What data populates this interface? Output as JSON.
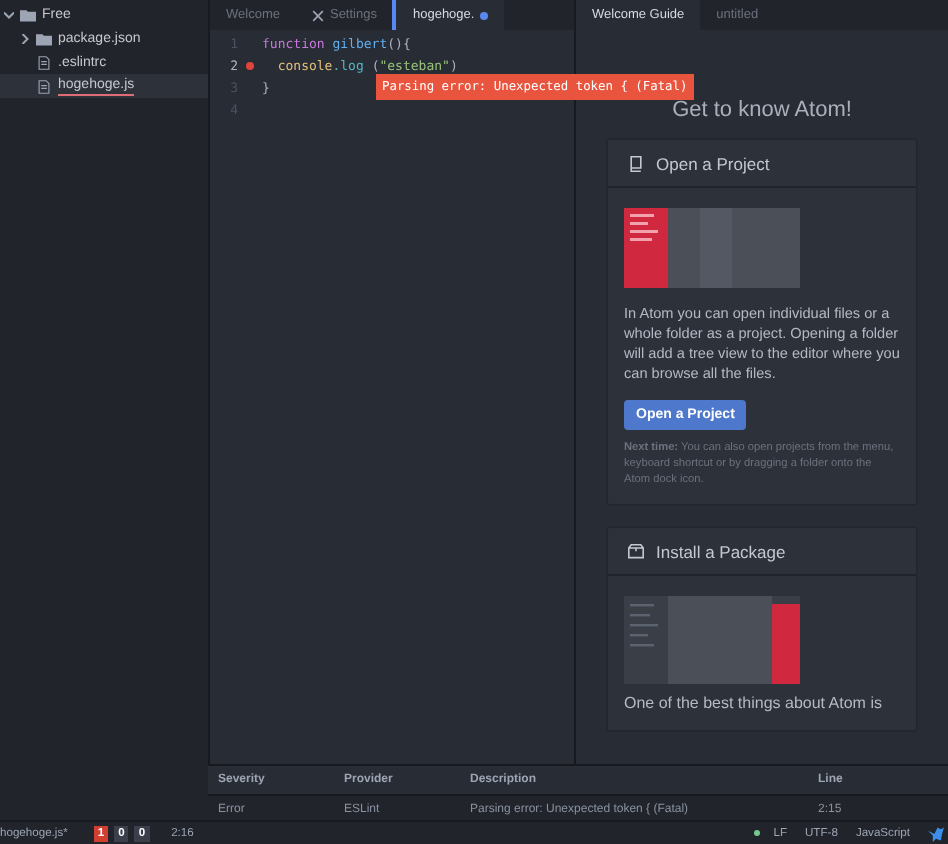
{
  "tree": {
    "label": "Free",
    "expanded": true,
    "children": [
      {
        "label": "package.json",
        "kind": "folder",
        "selected": false,
        "error": false
      },
      {
        "label": ".eslintrc",
        "kind": "file",
        "selected": false,
        "error": false
      },
      {
        "label": "hogehoge.js",
        "kind": "file",
        "selected": true,
        "error": true
      }
    ]
  },
  "editor_tabs": [
    {
      "label": "Welcome",
      "kind": "plain",
      "selected": false,
      "modified": false
    },
    {
      "label": "Settings",
      "kind": "settings",
      "selected": false,
      "modified": false
    },
    {
      "label": "hogehoge.",
      "kind": "plain",
      "selected": true,
      "modified": true
    }
  ],
  "code_lines": [
    {
      "number": "1",
      "error": false,
      "tokens": [
        {
          "text": "function ",
          "kind": "keyword"
        },
        {
          "text": "gilbert",
          "kind": "name"
        },
        {
          "text": "(){",
          "kind": "plain"
        }
      ]
    },
    {
      "number": "2",
      "error": true,
      "tokens": [
        {
          "text": "  console",
          "kind": "name2"
        },
        {
          "text": ".log ",
          "kind": "func"
        },
        {
          "text": "(",
          "kind": "plain"
        },
        {
          "text": "\"esteban\"",
          "kind": "string"
        },
        {
          "text": ")",
          "kind": "plain"
        }
      ]
    },
    {
      "number": "3",
      "error": false,
      "tokens": [
        {
          "text": "}",
          "kind": "plain"
        }
      ]
    },
    {
      "number": "4",
      "error": false
    }
  ],
  "error_tooltip": "Parsing error: Unexpected token { (Fatal)",
  "welcome_tabs": [
    {
      "label": "Welcome Guide",
      "selected": true
    },
    {
      "label": "untitled",
      "selected": false
    }
  ],
  "welcome_heading": "Get to know Atom!",
  "cards": [
    {
      "kind": "project",
      "title": "Open a Project",
      "description": "In Atom you can open individual files or a whole folder as a project. Opening a folder will add a tree view to the editor where you can browse all the files.",
      "button": "Open a Project",
      "note": "**Next time:** You can also open projects from the menu, keyboard shortcut or by dragging a folder onto the Atom dock icon."
    },
    {
      "kind": "package",
      "title": "Install a Package",
      "description": "One of the best things about Atom is"
    }
  ],
  "linter": {
    "columns": [
      "Severity",
      "Provider",
      "Description",
      "Line"
    ],
    "rows": [
      [
        "Error",
        "ESLint",
        "Parsing error: Unexpected token { (Fatal)",
        "2:15"
      ]
    ]
  },
  "status_bar": {
    "file": "hogehoge.js*",
    "counts": [
      {
        "value": "1",
        "kind": "error"
      },
      {
        "value": "0",
        "kind": "warning"
      },
      {
        "value": "0",
        "kind": "info"
      }
    ],
    "cursor": "2:16",
    "right": [
      "LF",
      "UTF-8",
      "JavaScript"
    ]
  }
}
